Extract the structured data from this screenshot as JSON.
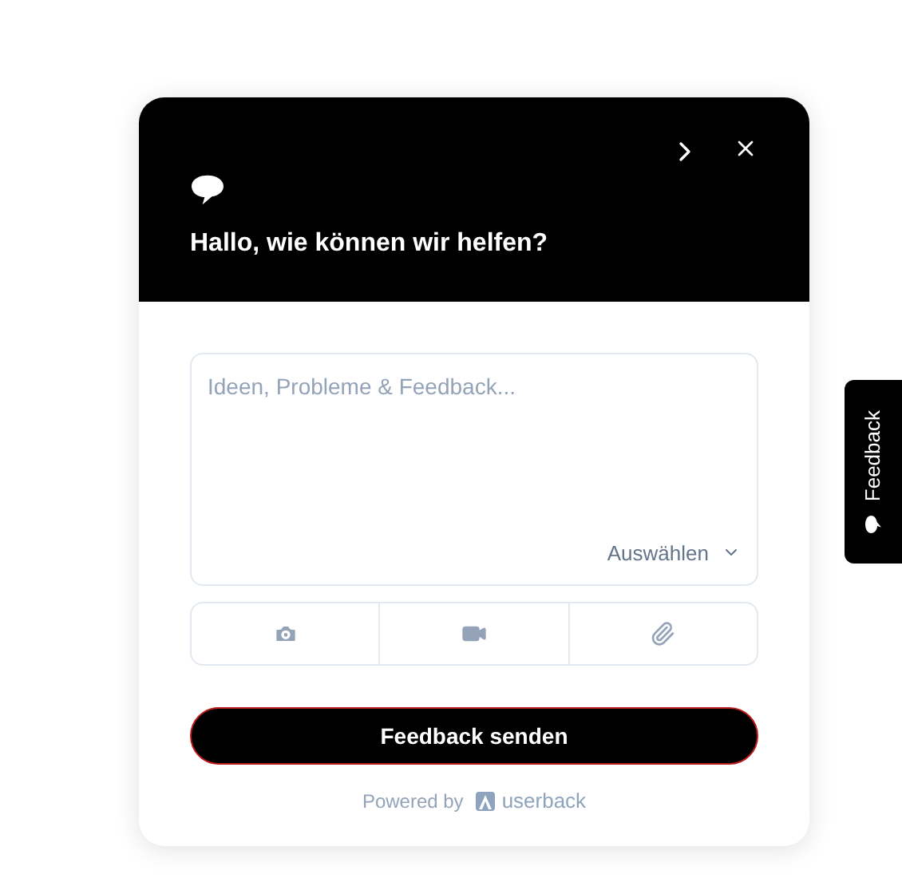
{
  "header": {
    "title": "Hallo, wie können wir helfen?"
  },
  "message": {
    "placeholder": "Ideen, Probleme & Feedback..."
  },
  "category_select": {
    "label": "Auswählen"
  },
  "attachments": [
    {
      "kind": "screenshot"
    },
    {
      "kind": "video"
    },
    {
      "kind": "file"
    }
  ],
  "submit_button": {
    "label": "Feedback senden"
  },
  "footer": {
    "powered_by": "Powered by",
    "brand": "userback"
  },
  "side_tab": {
    "label": "Feedback"
  }
}
